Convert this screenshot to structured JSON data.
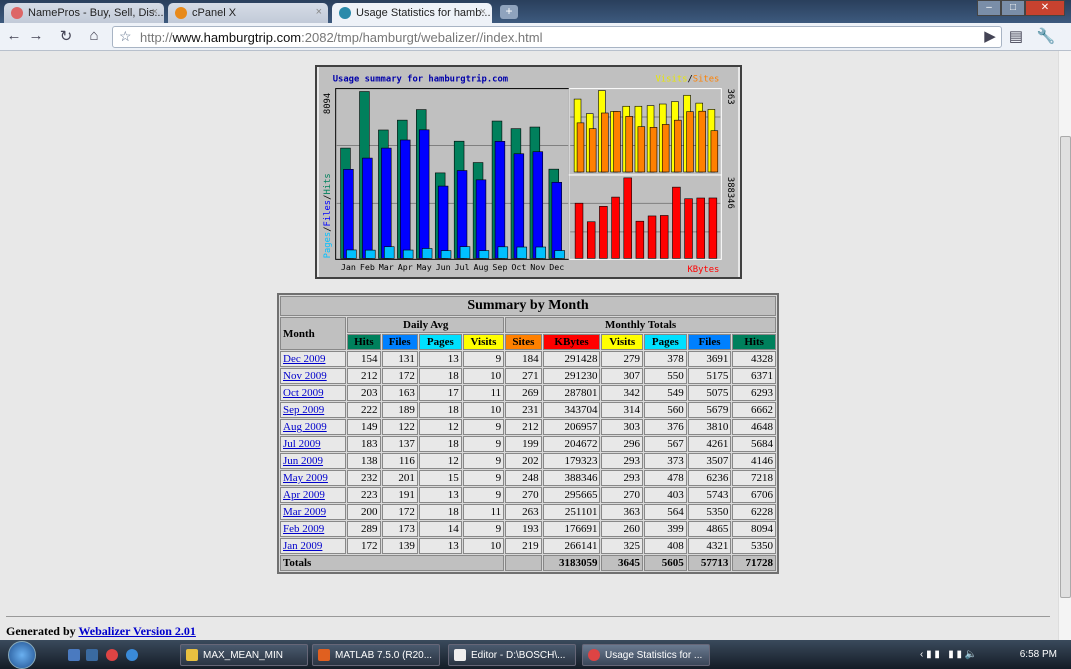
{
  "browser": {
    "tabs": [
      {
        "label": "NamePros - Buy, Sell, Dis...",
        "icon": "namepros-icon"
      },
      {
        "label": "cPanel X",
        "icon": "cpanel-icon"
      },
      {
        "label": "Usage Statistics for hamb...",
        "icon": "webalizer-icon"
      }
    ],
    "url_scheme": "http://",
    "url_host": "www.hamburgtrip.com",
    "url_rest": ":2082/tmp/hamburgt/webalizer//index.html"
  },
  "chart": {
    "title": "Usage summary for hamburgtrip.com",
    "legend_right_visits": "Visits",
    "legend_sep": "/",
    "legend_right_sites": "Sites",
    "legend_left_pages": "Pages",
    "legend_left_files": "Files",
    "legend_left_hits": "Hits",
    "kbytes_label": "KBytes",
    "max_hits": "8094",
    "max_visits": "363",
    "max_kbytes": "388346",
    "colors": {
      "hits": "#00805c",
      "files": "#0000ff",
      "pages": "#00c0ff",
      "visits": "#ffff00",
      "sites": "#ff8000",
      "kbytes": "#ff0000"
    }
  },
  "chart_data": {
    "type": "bar",
    "title": "Usage summary for hamburgtrip.com",
    "categories": [
      "Jan",
      "Feb",
      "Mar",
      "Apr",
      "May",
      "Jun",
      "Jul",
      "Aug",
      "Sep",
      "Oct",
      "Nov",
      "Dec"
    ],
    "series": [
      {
        "name": "Hits",
        "values": [
          5350,
          8094,
          6228,
          6706,
          7218,
          4146,
          5684,
          4648,
          6662,
          6293,
          6371,
          4328
        ]
      },
      {
        "name": "Files",
        "values": [
          4321,
          4865,
          5350,
          5743,
          6236,
          3507,
          4261,
          3810,
          5679,
          5075,
          5175,
          3691
        ]
      },
      {
        "name": "Pages",
        "values": [
          408,
          399,
          564,
          403,
          478,
          373,
          567,
          376,
          560,
          549,
          550,
          378
        ]
      },
      {
        "name": "Visits",
        "values": [
          325,
          260,
          363,
          270,
          293,
          293,
          296,
          303,
          314,
          342,
          307,
          279
        ]
      },
      {
        "name": "Sites",
        "values": [
          219,
          193,
          263,
          270,
          248,
          202,
          199,
          212,
          231,
          269,
          271,
          184
        ]
      },
      {
        "name": "KBytes",
        "values": [
          266141,
          176691,
          251101,
          295665,
          388346,
          179323,
          204672,
          206957,
          343704,
          287801,
          291230,
          291428
        ]
      }
    ],
    "ylim_hits": [
      0,
      8094
    ],
    "ylim_visits": [
      0,
      363
    ],
    "ylim_kbytes": [
      0,
      388346
    ]
  },
  "table": {
    "title": "Summary by Month",
    "month_header": "Month",
    "daily_avg": "Daily Avg",
    "monthly_totals": "Monthly Totals",
    "columns": [
      {
        "label": "Hits",
        "color": "#00805c"
      },
      {
        "label": "Files",
        "color": "#0080ff"
      },
      {
        "label": "Pages",
        "color": "#00e0ff"
      },
      {
        "label": "Visits",
        "color": "#ffff00"
      },
      {
        "label": "Sites",
        "color": "#ff8000"
      },
      {
        "label": "KBytes",
        "color": "#ff0000"
      },
      {
        "label": "Visits",
        "color": "#ffff00"
      },
      {
        "label": "Pages",
        "color": "#00e0ff"
      },
      {
        "label": "Files",
        "color": "#0080ff"
      },
      {
        "label": "Hits",
        "color": "#00805c"
      }
    ],
    "rows": [
      [
        "Dec 2009",
        "154",
        "131",
        "13",
        "9",
        "184",
        "291428",
        "279",
        "378",
        "3691",
        "4328"
      ],
      [
        "Nov 2009",
        "212",
        "172",
        "18",
        "10",
        "271",
        "291230",
        "307",
        "550",
        "5175",
        "6371"
      ],
      [
        "Oct 2009",
        "203",
        "163",
        "17",
        "11",
        "269",
        "287801",
        "342",
        "549",
        "5075",
        "6293"
      ],
      [
        "Sep 2009",
        "222",
        "189",
        "18",
        "10",
        "231",
        "343704",
        "314",
        "560",
        "5679",
        "6662"
      ],
      [
        "Aug 2009",
        "149",
        "122",
        "12",
        "9",
        "212",
        "206957",
        "303",
        "376",
        "3810",
        "4648"
      ],
      [
        "Jul 2009",
        "183",
        "137",
        "18",
        "9",
        "199",
        "204672",
        "296",
        "567",
        "4261",
        "5684"
      ],
      [
        "Jun 2009",
        "138",
        "116",
        "12",
        "9",
        "202",
        "179323",
        "293",
        "373",
        "3507",
        "4146"
      ],
      [
        "May 2009",
        "232",
        "201",
        "15",
        "9",
        "248",
        "388346",
        "293",
        "478",
        "6236",
        "7218"
      ],
      [
        "Apr 2009",
        "223",
        "191",
        "13",
        "9",
        "270",
        "295665",
        "270",
        "403",
        "5743",
        "6706"
      ],
      [
        "Mar 2009",
        "200",
        "172",
        "18",
        "11",
        "263",
        "251101",
        "363",
        "564",
        "5350",
        "6228"
      ],
      [
        "Feb 2009",
        "289",
        "173",
        "14",
        "9",
        "193",
        "176691",
        "260",
        "399",
        "4865",
        "8094"
      ],
      [
        "Jan 2009",
        "172",
        "139",
        "13",
        "10",
        "219",
        "266141",
        "325",
        "408",
        "4321",
        "5350"
      ]
    ],
    "totals_label": "Totals",
    "totals": [
      "3183059",
      "3645",
      "5605",
      "57713",
      "71728"
    ]
  },
  "footer": {
    "prefix": "Generated by ",
    "link": "Webalizer Version 2.01"
  },
  "taskbar": {
    "tasks": [
      "MAX_MEAN_MIN",
      "MATLAB 7.5.0 (R20...",
      "Editor - D:\\BOSCH\\...",
      "Usage Statistics for ..."
    ],
    "clock": "6:58 PM"
  }
}
